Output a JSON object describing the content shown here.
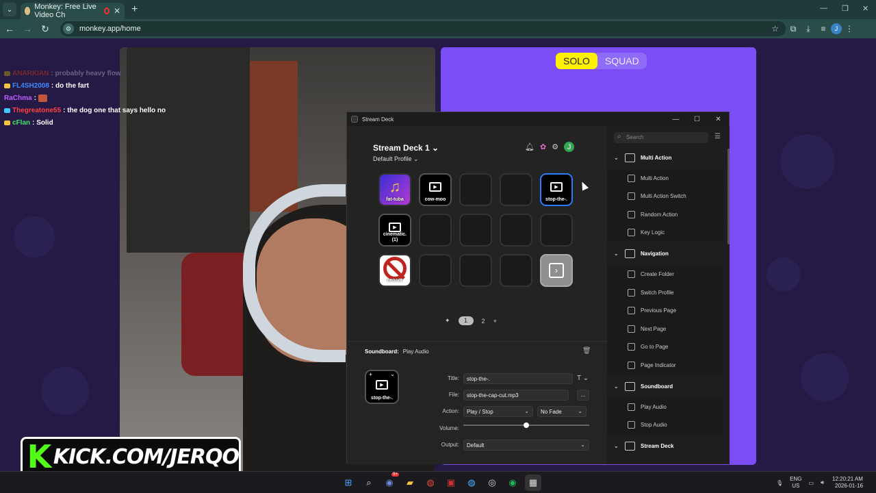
{
  "browser": {
    "tab_title": "Monkey: Free Live Video Ch",
    "url": "monkey.app/home",
    "profile_initial": "J"
  },
  "chat": [
    {
      "user": "ANARKIAN",
      "user_color": "#7a2a2a",
      "message": ": probably heavy flow"
    },
    {
      "user": "FL4SH2008",
      "user_color": "#3d8bff",
      "message": ": do the fart"
    },
    {
      "user": "RaChma",
      "user_color": "#c05cff",
      "message": ":"
    },
    {
      "user": "Thegreatone55",
      "user_color": "#ff4040",
      "message": ": the dog one that says hello no"
    },
    {
      "user": "cFlan",
      "user_color": "#3ee36b",
      "message": ": Solid"
    }
  ],
  "monkey": {
    "solo": "SOLO",
    "squad": "SQUAD"
  },
  "kick_banner": {
    "logo": "K",
    "text": "KICK.COM/JERQO"
  },
  "stream_deck": {
    "window_title": "Stream Deck",
    "device_name": "Stream Deck 1",
    "profile_name": "Default Profile",
    "avatar_initial": "J",
    "keys": [
      {
        "label": "fat-tuba",
        "style": "tuba"
      },
      {
        "label": "cow-moo",
        "style": "play"
      },
      {
        "label": "",
        "style": "empty"
      },
      {
        "label": "",
        "style": "empty"
      },
      {
        "label": "stop-the-.",
        "style": "play-selected"
      },
      {
        "label": "cinematic. (1)",
        "style": "play"
      },
      {
        "label": "",
        "style": "empty"
      },
      {
        "label": "",
        "style": "empty"
      },
      {
        "label": "",
        "style": "empty"
      },
      {
        "label": "",
        "style": "empty"
      },
      {
        "label": "censor",
        "style": "censor"
      },
      {
        "label": "",
        "style": "empty"
      },
      {
        "label": "",
        "style": "empty"
      },
      {
        "label": "",
        "style": "empty"
      },
      {
        "label": "",
        "style": "next"
      }
    ],
    "pager": {
      "pin": "✦",
      "page1": "1",
      "page2": "2",
      "add": "+"
    },
    "inspector": {
      "category": "Soundboard:",
      "action": "Play Audio",
      "key_label": "stop-the-.",
      "title_label": "Title:",
      "title_value": "stop-the-.",
      "file_label": "File:",
      "file_value": "stop-the-cap-cut.mp3",
      "browse": "...",
      "action_label": "Action:",
      "action_value": "Play / Stop",
      "fade_value": "No Fade",
      "volume_label": "Volume:",
      "volume_level": 0.5,
      "output_label": "Output:",
      "output_value": "Default"
    },
    "sidebar": {
      "search_placeholder": "Search",
      "categories": [
        {
          "name": "Multi Action",
          "actions": [
            "Multi Action",
            "Multi Action Switch",
            "Random Action",
            "Key Logic"
          ]
        },
        {
          "name": "Navigation",
          "actions": [
            "Create Folder",
            "Switch Profile",
            "Previous Page",
            "Next Page",
            "Go to Page",
            "Page Indicator"
          ]
        },
        {
          "name": "Soundboard",
          "actions": [
            "Play Audio",
            "Stop Audio"
          ]
        },
        {
          "name": "Stream Deck",
          "actions": []
        }
      ]
    }
  },
  "taskbar": {
    "lang_top": "ENG",
    "lang_bottom": "US",
    "time": "12:20:21 AM",
    "date": "2026-01-16",
    "discord_badge": "9+"
  }
}
